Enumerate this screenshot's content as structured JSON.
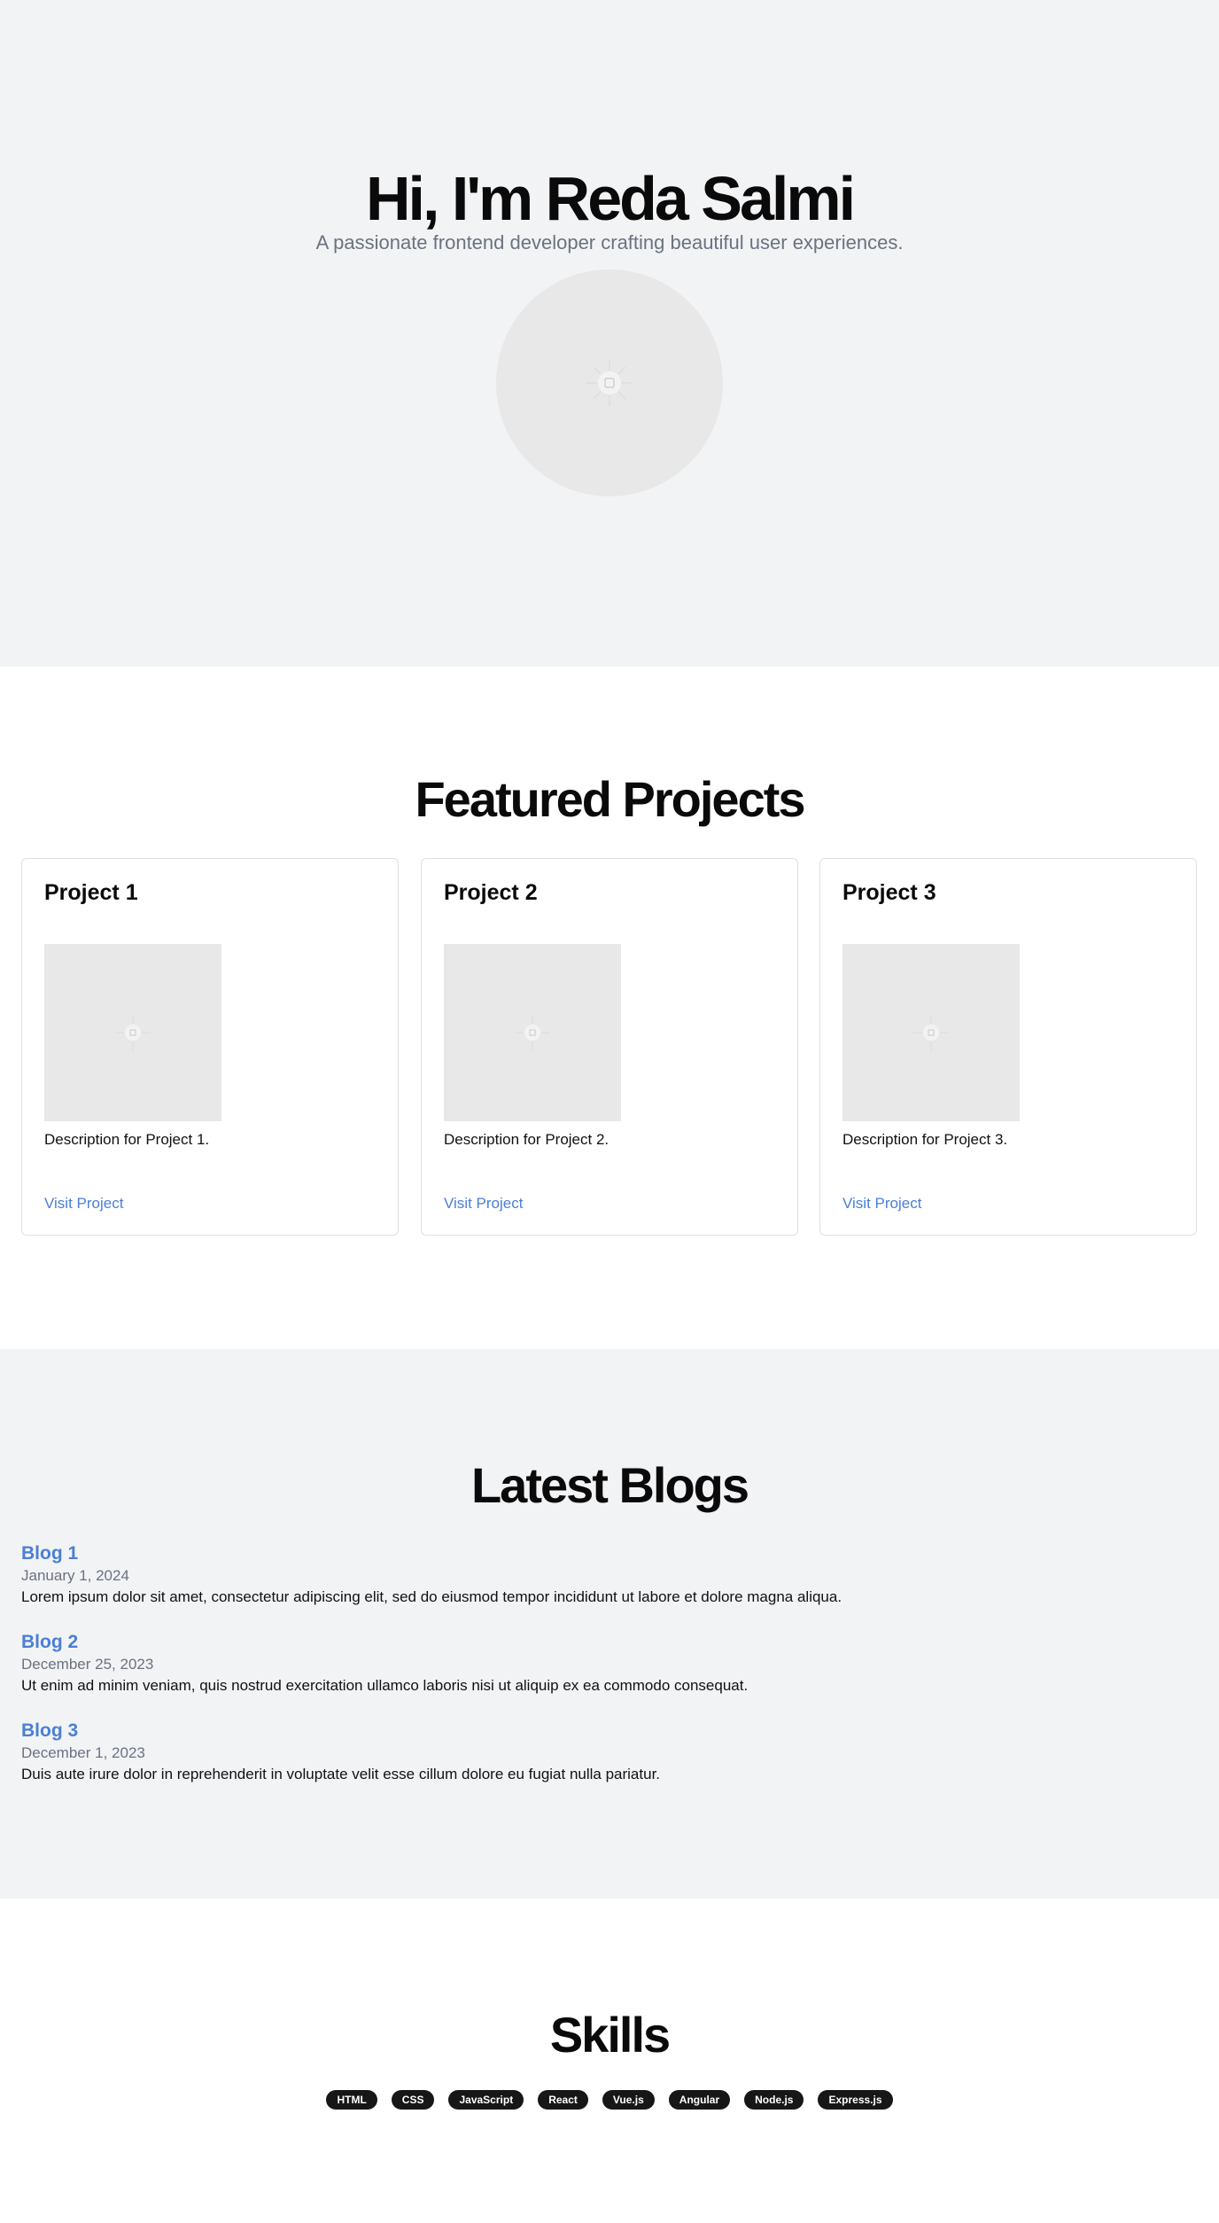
{
  "hero": {
    "title": "Hi, I'm Reda Salmi",
    "subtitle": "A passionate frontend developer crafting beautiful user experiences."
  },
  "projects": {
    "heading": "Featured Projects",
    "items": [
      {
        "title": "Project 1",
        "description": "Description for Project 1.",
        "link_label": "Visit Project"
      },
      {
        "title": "Project 2",
        "description": "Description for Project 2.",
        "link_label": "Visit Project"
      },
      {
        "title": "Project 3",
        "description": "Description for Project 3.",
        "link_label": "Visit Project"
      }
    ]
  },
  "blogs": {
    "heading": "Latest Blogs",
    "items": [
      {
        "title": "Blog 1",
        "date": "January 1, 2024",
        "excerpt": "Lorem ipsum dolor sit amet, consectetur adipiscing elit, sed do eiusmod tempor incididunt ut labore et dolore magna aliqua."
      },
      {
        "title": "Blog 2",
        "date": "December 25, 2023",
        "excerpt": "Ut enim ad minim veniam, quis nostrud exercitation ullamco laboris nisi ut aliquip ex ea commodo consequat."
      },
      {
        "title": "Blog 3",
        "date": "December 1, 2023",
        "excerpt": "Duis aute irure dolor in reprehenderit in voluptate velit esse cillum dolore eu fugiat nulla pariatur."
      }
    ]
  },
  "skills": {
    "heading": "Skills",
    "items": [
      "HTML",
      "CSS",
      "JavaScript",
      "React",
      "Vue.js",
      "Angular",
      "Node.js",
      "Express.js"
    ]
  },
  "colors": {
    "accent": "#4a7fd4",
    "section_bg": "#f2f3f5",
    "placeholder_bg": "#e8e8e8",
    "pill_bg": "#171717"
  }
}
